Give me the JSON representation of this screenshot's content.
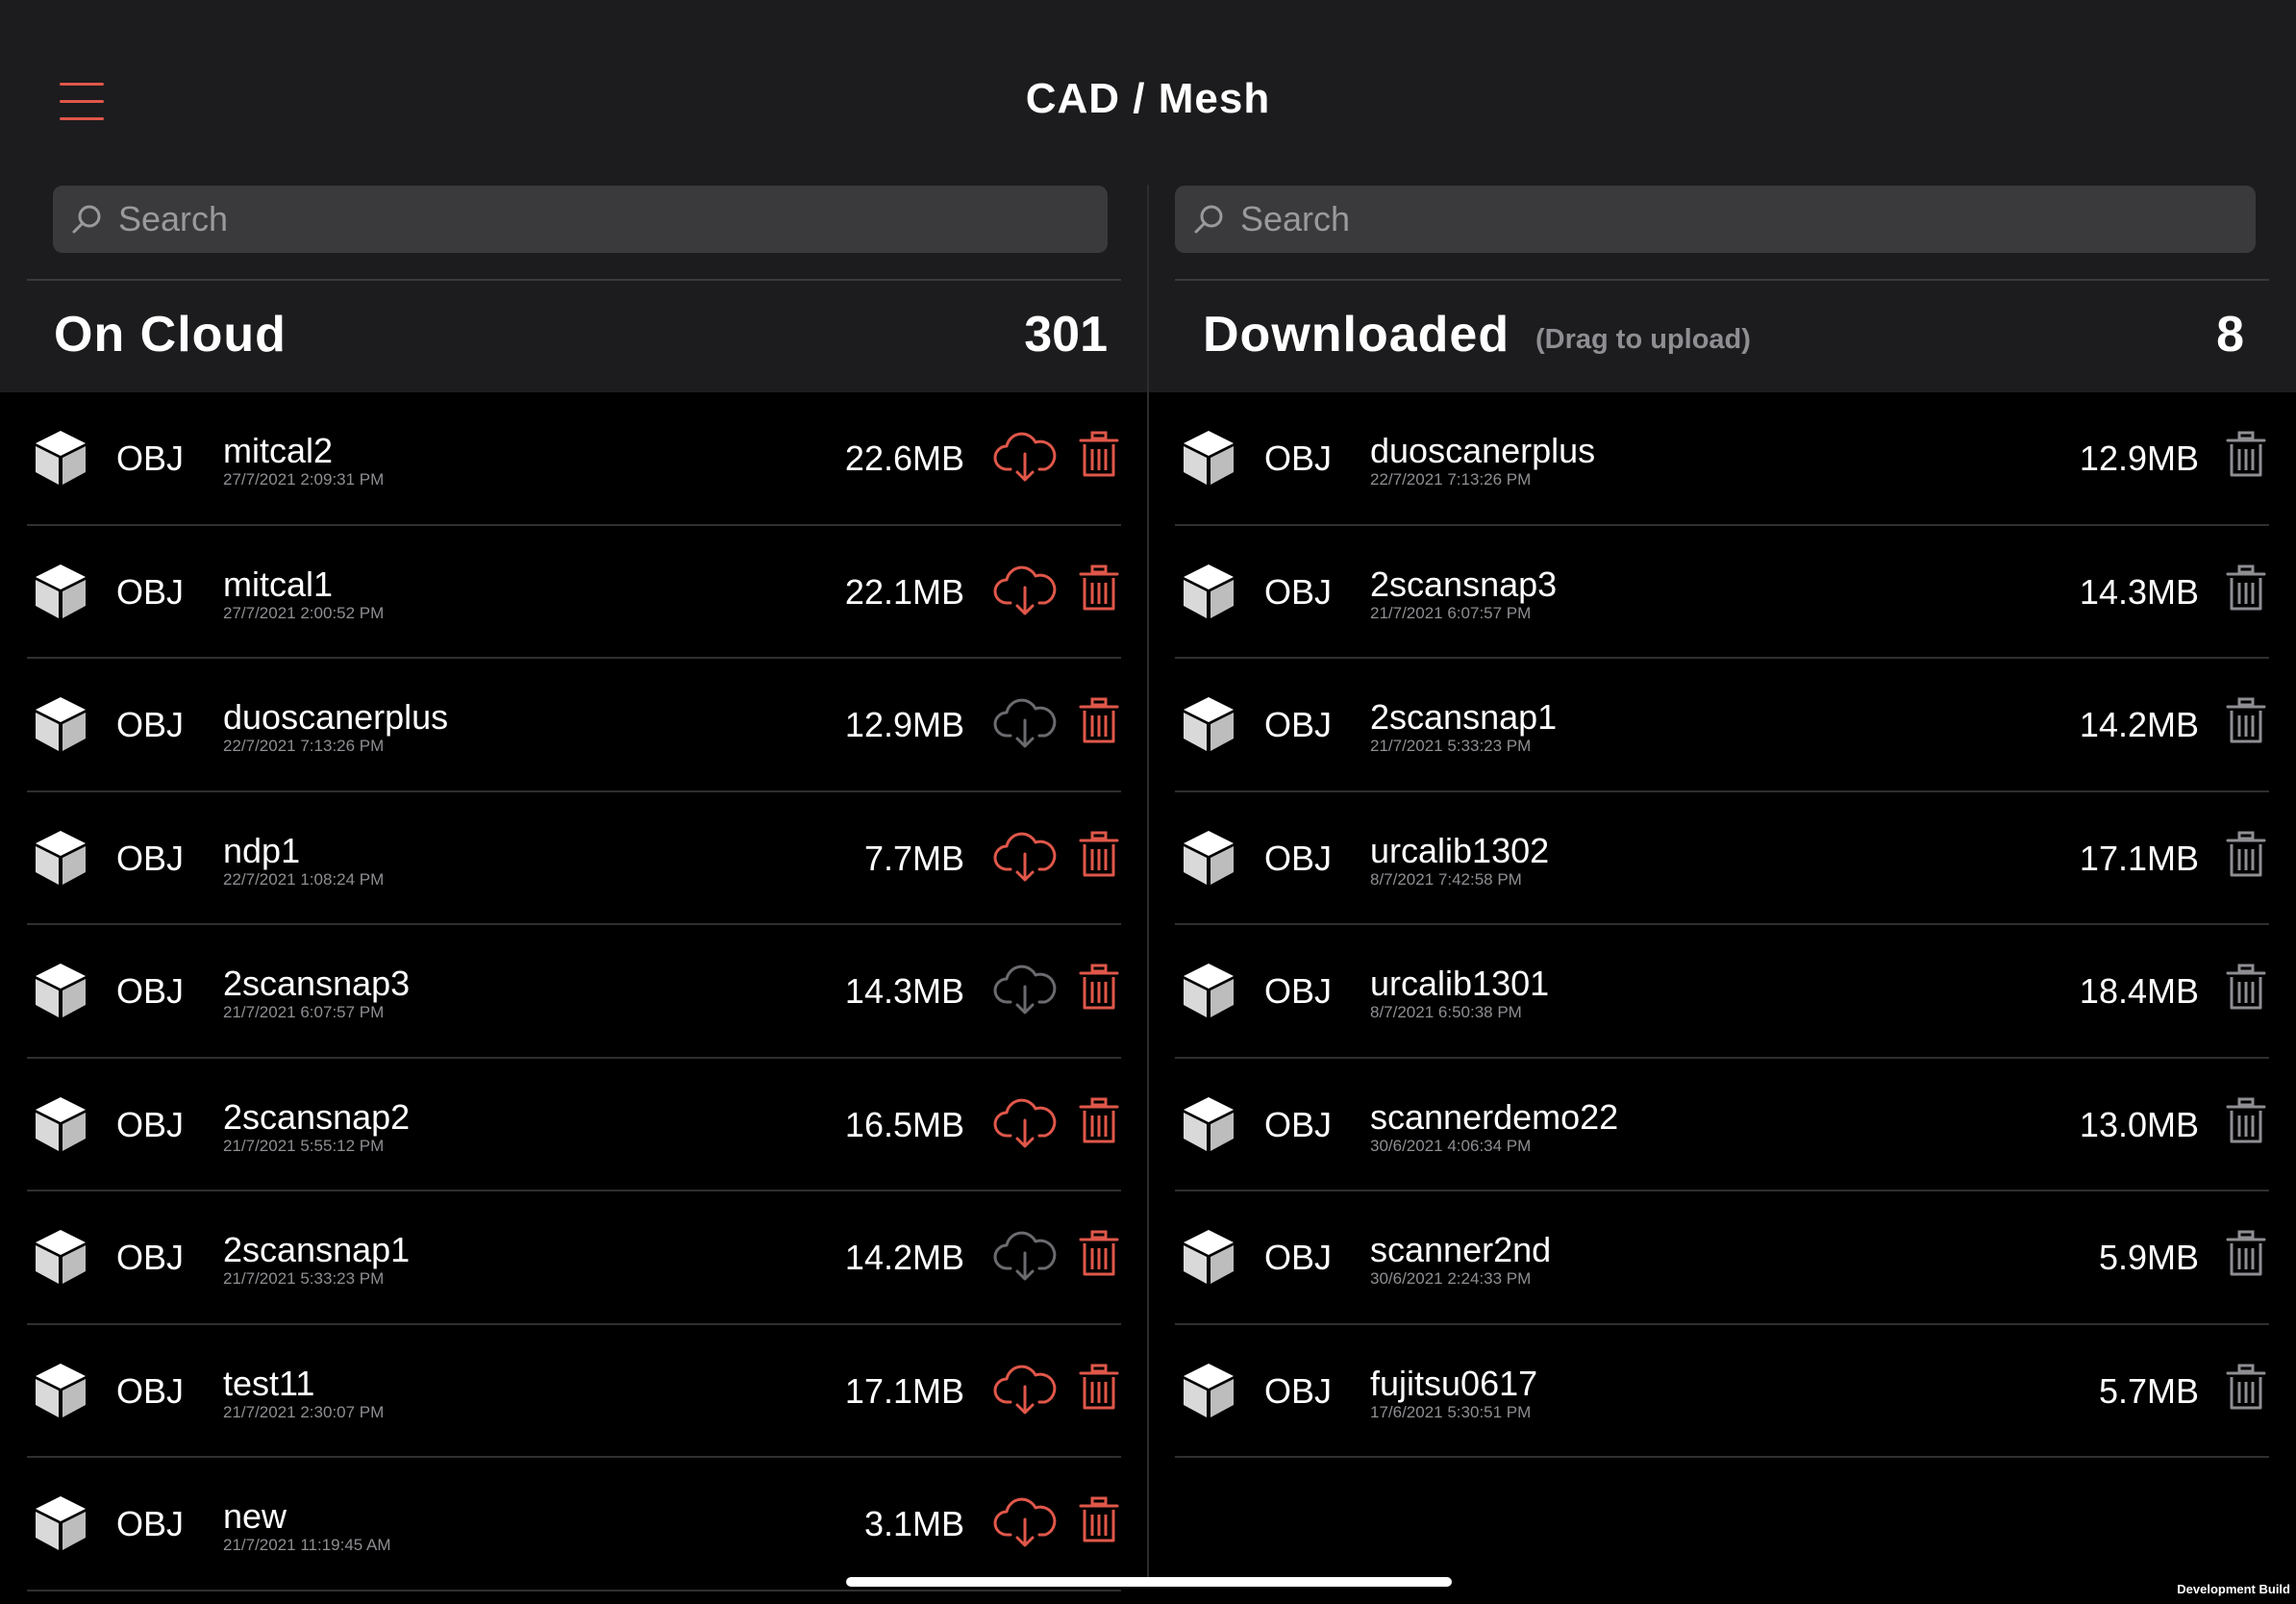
{
  "header": {
    "title": "CAD / Mesh"
  },
  "colors": {
    "accent": "#e0574a",
    "muted_icon": "#6b6b6f",
    "trash_gray": "#8e8e93"
  },
  "left": {
    "search_placeholder": "Search",
    "title": "On Cloud",
    "count": "301",
    "items": [
      {
        "format": "OBJ",
        "name": "mitcal2",
        "date": "27/7/2021 2:09:31 PM",
        "size": "22.6MB",
        "cloud_state": "available"
      },
      {
        "format": "OBJ",
        "name": "mitcal1",
        "date": "27/7/2021 2:00:52 PM",
        "size": "22.1MB",
        "cloud_state": "available"
      },
      {
        "format": "OBJ",
        "name": "duoscanerplus",
        "date": "22/7/2021 7:13:26 PM",
        "size": "12.9MB",
        "cloud_state": "downloaded"
      },
      {
        "format": "OBJ",
        "name": "ndp1",
        "date": "22/7/2021 1:08:24 PM",
        "size": "7.7MB",
        "cloud_state": "available"
      },
      {
        "format": "OBJ",
        "name": "2scansnap3",
        "date": "21/7/2021 6:07:57 PM",
        "size": "14.3MB",
        "cloud_state": "downloaded"
      },
      {
        "format": "OBJ",
        "name": "2scansnap2",
        "date": "21/7/2021 5:55:12 PM",
        "size": "16.5MB",
        "cloud_state": "available"
      },
      {
        "format": "OBJ",
        "name": "2scansnap1",
        "date": "21/7/2021 5:33:23 PM",
        "size": "14.2MB",
        "cloud_state": "downloaded"
      },
      {
        "format": "OBJ",
        "name": "test11",
        "date": "21/7/2021 2:30:07 PM",
        "size": "17.1MB",
        "cloud_state": "available"
      },
      {
        "format": "OBJ",
        "name": "new",
        "date": "21/7/2021 11:19:45 AM",
        "size": "3.1MB",
        "cloud_state": "available"
      }
    ]
  },
  "right": {
    "search_placeholder": "Search",
    "title": "Downloaded",
    "subtitle": "(Drag to upload)",
    "count": "8",
    "items": [
      {
        "format": "OBJ",
        "name": "duoscanerplus",
        "date": "22/7/2021 7:13:26 PM",
        "size": "12.9MB"
      },
      {
        "format": "OBJ",
        "name": "2scansnap3",
        "date": "21/7/2021 6:07:57 PM",
        "size": "14.3MB"
      },
      {
        "format": "OBJ",
        "name": "2scansnap1",
        "date": "21/7/2021 5:33:23 PM",
        "size": "14.2MB"
      },
      {
        "format": "OBJ",
        "name": "urcalib1302",
        "date": "8/7/2021 7:42:58 PM",
        "size": "17.1MB"
      },
      {
        "format": "OBJ",
        "name": "urcalib1301",
        "date": "8/7/2021 6:50:38 PM",
        "size": "18.4MB"
      },
      {
        "format": "OBJ",
        "name": "scannerdemo22",
        "date": "30/6/2021 4:06:34 PM",
        "size": "13.0MB"
      },
      {
        "format": "OBJ",
        "name": "scanner2nd",
        "date": "30/6/2021 2:24:33 PM",
        "size": "5.9MB"
      },
      {
        "format": "OBJ",
        "name": "fujitsu0617",
        "date": "17/6/2021 5:30:51 PM",
        "size": "5.7MB"
      }
    ]
  },
  "footer": {
    "build_label": "Development Build"
  }
}
